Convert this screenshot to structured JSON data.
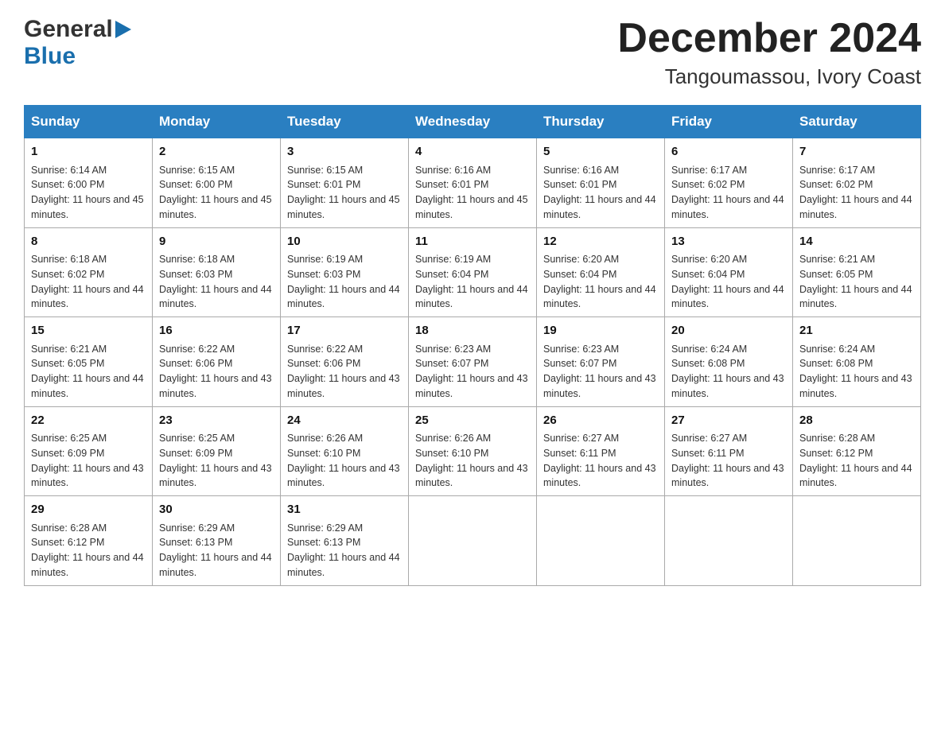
{
  "header": {
    "logo_general": "General",
    "logo_blue": "Blue",
    "month_title": "December 2024",
    "location": "Tangoumassou, Ivory Coast"
  },
  "days_of_week": [
    "Sunday",
    "Monday",
    "Tuesday",
    "Wednesday",
    "Thursday",
    "Friday",
    "Saturday"
  ],
  "weeks": [
    [
      {
        "day": "1",
        "sunrise": "Sunrise: 6:14 AM",
        "sunset": "Sunset: 6:00 PM",
        "daylight": "Daylight: 11 hours and 45 minutes."
      },
      {
        "day": "2",
        "sunrise": "Sunrise: 6:15 AM",
        "sunset": "Sunset: 6:00 PM",
        "daylight": "Daylight: 11 hours and 45 minutes."
      },
      {
        "day": "3",
        "sunrise": "Sunrise: 6:15 AM",
        "sunset": "Sunset: 6:01 PM",
        "daylight": "Daylight: 11 hours and 45 minutes."
      },
      {
        "day": "4",
        "sunrise": "Sunrise: 6:16 AM",
        "sunset": "Sunset: 6:01 PM",
        "daylight": "Daylight: 11 hours and 45 minutes."
      },
      {
        "day": "5",
        "sunrise": "Sunrise: 6:16 AM",
        "sunset": "Sunset: 6:01 PM",
        "daylight": "Daylight: 11 hours and 44 minutes."
      },
      {
        "day": "6",
        "sunrise": "Sunrise: 6:17 AM",
        "sunset": "Sunset: 6:02 PM",
        "daylight": "Daylight: 11 hours and 44 minutes."
      },
      {
        "day": "7",
        "sunrise": "Sunrise: 6:17 AM",
        "sunset": "Sunset: 6:02 PM",
        "daylight": "Daylight: 11 hours and 44 minutes."
      }
    ],
    [
      {
        "day": "8",
        "sunrise": "Sunrise: 6:18 AM",
        "sunset": "Sunset: 6:02 PM",
        "daylight": "Daylight: 11 hours and 44 minutes."
      },
      {
        "day": "9",
        "sunrise": "Sunrise: 6:18 AM",
        "sunset": "Sunset: 6:03 PM",
        "daylight": "Daylight: 11 hours and 44 minutes."
      },
      {
        "day": "10",
        "sunrise": "Sunrise: 6:19 AM",
        "sunset": "Sunset: 6:03 PM",
        "daylight": "Daylight: 11 hours and 44 minutes."
      },
      {
        "day": "11",
        "sunrise": "Sunrise: 6:19 AM",
        "sunset": "Sunset: 6:04 PM",
        "daylight": "Daylight: 11 hours and 44 minutes."
      },
      {
        "day": "12",
        "sunrise": "Sunrise: 6:20 AM",
        "sunset": "Sunset: 6:04 PM",
        "daylight": "Daylight: 11 hours and 44 minutes."
      },
      {
        "day": "13",
        "sunrise": "Sunrise: 6:20 AM",
        "sunset": "Sunset: 6:04 PM",
        "daylight": "Daylight: 11 hours and 44 minutes."
      },
      {
        "day": "14",
        "sunrise": "Sunrise: 6:21 AM",
        "sunset": "Sunset: 6:05 PM",
        "daylight": "Daylight: 11 hours and 44 minutes."
      }
    ],
    [
      {
        "day": "15",
        "sunrise": "Sunrise: 6:21 AM",
        "sunset": "Sunset: 6:05 PM",
        "daylight": "Daylight: 11 hours and 44 minutes."
      },
      {
        "day": "16",
        "sunrise": "Sunrise: 6:22 AM",
        "sunset": "Sunset: 6:06 PM",
        "daylight": "Daylight: 11 hours and 43 minutes."
      },
      {
        "day": "17",
        "sunrise": "Sunrise: 6:22 AM",
        "sunset": "Sunset: 6:06 PM",
        "daylight": "Daylight: 11 hours and 43 minutes."
      },
      {
        "day": "18",
        "sunrise": "Sunrise: 6:23 AM",
        "sunset": "Sunset: 6:07 PM",
        "daylight": "Daylight: 11 hours and 43 minutes."
      },
      {
        "day": "19",
        "sunrise": "Sunrise: 6:23 AM",
        "sunset": "Sunset: 6:07 PM",
        "daylight": "Daylight: 11 hours and 43 minutes."
      },
      {
        "day": "20",
        "sunrise": "Sunrise: 6:24 AM",
        "sunset": "Sunset: 6:08 PM",
        "daylight": "Daylight: 11 hours and 43 minutes."
      },
      {
        "day": "21",
        "sunrise": "Sunrise: 6:24 AM",
        "sunset": "Sunset: 6:08 PM",
        "daylight": "Daylight: 11 hours and 43 minutes."
      }
    ],
    [
      {
        "day": "22",
        "sunrise": "Sunrise: 6:25 AM",
        "sunset": "Sunset: 6:09 PM",
        "daylight": "Daylight: 11 hours and 43 minutes."
      },
      {
        "day": "23",
        "sunrise": "Sunrise: 6:25 AM",
        "sunset": "Sunset: 6:09 PM",
        "daylight": "Daylight: 11 hours and 43 minutes."
      },
      {
        "day": "24",
        "sunrise": "Sunrise: 6:26 AM",
        "sunset": "Sunset: 6:10 PM",
        "daylight": "Daylight: 11 hours and 43 minutes."
      },
      {
        "day": "25",
        "sunrise": "Sunrise: 6:26 AM",
        "sunset": "Sunset: 6:10 PM",
        "daylight": "Daylight: 11 hours and 43 minutes."
      },
      {
        "day": "26",
        "sunrise": "Sunrise: 6:27 AM",
        "sunset": "Sunset: 6:11 PM",
        "daylight": "Daylight: 11 hours and 43 minutes."
      },
      {
        "day": "27",
        "sunrise": "Sunrise: 6:27 AM",
        "sunset": "Sunset: 6:11 PM",
        "daylight": "Daylight: 11 hours and 43 minutes."
      },
      {
        "day": "28",
        "sunrise": "Sunrise: 6:28 AM",
        "sunset": "Sunset: 6:12 PM",
        "daylight": "Daylight: 11 hours and 44 minutes."
      }
    ],
    [
      {
        "day": "29",
        "sunrise": "Sunrise: 6:28 AM",
        "sunset": "Sunset: 6:12 PM",
        "daylight": "Daylight: 11 hours and 44 minutes."
      },
      {
        "day": "30",
        "sunrise": "Sunrise: 6:29 AM",
        "sunset": "Sunset: 6:13 PM",
        "daylight": "Daylight: 11 hours and 44 minutes."
      },
      {
        "day": "31",
        "sunrise": "Sunrise: 6:29 AM",
        "sunset": "Sunset: 6:13 PM",
        "daylight": "Daylight: 11 hours and 44 minutes."
      },
      null,
      null,
      null,
      null
    ]
  ]
}
